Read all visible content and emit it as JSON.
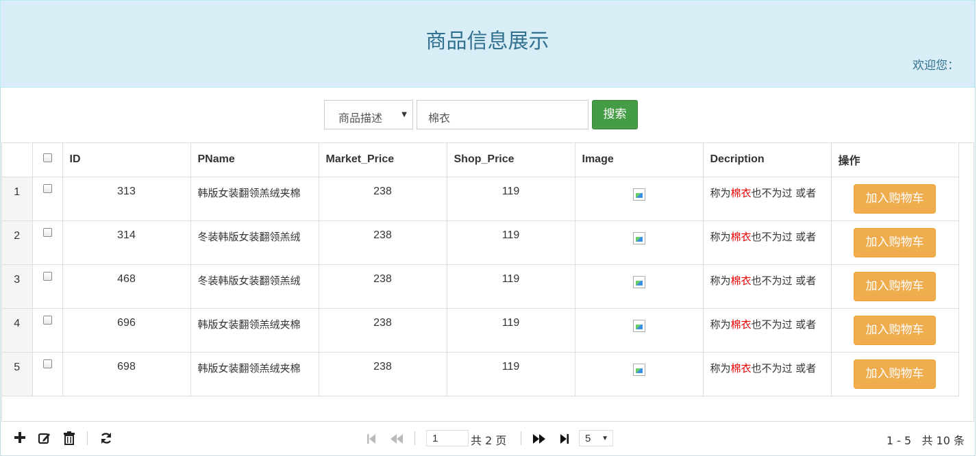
{
  "header": {
    "title": "商品信息展示",
    "welcome": "欢迎您："
  },
  "search": {
    "field_selected": "商品描述",
    "query": "棉衣",
    "button": "搜索"
  },
  "table": {
    "columns": [
      "ID",
      "PName",
      "Market_Price",
      "Shop_Price",
      "Image",
      "Decription",
      "操作"
    ],
    "rows": [
      {
        "num": "1",
        "id": "313",
        "pname": "韩版女装翻领羔绒夹棉",
        "market": "238",
        "shop": "119",
        "desc_pre": "称为",
        "desc_hl": "棉衣",
        "desc_post": "也不为过 或者",
        "action": "加入购物车"
      },
      {
        "num": "2",
        "id": "314",
        "pname": "冬装韩版女装翻领羔绒",
        "market": "238",
        "shop": "119",
        "desc_pre": "称为",
        "desc_hl": "棉衣",
        "desc_post": "也不为过 或者",
        "action": "加入购物车"
      },
      {
        "num": "3",
        "id": "468",
        "pname": "冬装韩版女装翻领羔绒",
        "market": "238",
        "shop": "119",
        "desc_pre": "称为",
        "desc_hl": "棉衣",
        "desc_post": "也不为过 或者",
        "action": "加入购物车"
      },
      {
        "num": "4",
        "id": "696",
        "pname": "韩版女装翻领羔绒夹棉",
        "market": "238",
        "shop": "119",
        "desc_pre": "称为",
        "desc_hl": "棉衣",
        "desc_post": "也不为过 或者",
        "action": "加入购物车"
      },
      {
        "num": "5",
        "id": "698",
        "pname": "韩版女装翻领羔绒夹棉",
        "market": "238",
        "shop": "119",
        "desc_pre": "称为",
        "desc_hl": "棉衣",
        "desc_post": "也不为过 或者",
        "action": "加入购物车"
      }
    ]
  },
  "pager": {
    "current_page": "1",
    "total_pages": "共 2 页",
    "page_size": "5",
    "range": "1 - 5   共 10 条"
  },
  "colors": {
    "header_bg": "#d9edf7",
    "title": "#31708f",
    "search_btn": "#449d44",
    "cart_btn": "#f0ad4e",
    "highlight": "#e00000"
  },
  "icons": [
    "plus-icon",
    "edit-icon",
    "trash-icon",
    "refresh-icon",
    "first-page-icon",
    "prev-page-icon",
    "next-page-icon",
    "last-page-icon"
  ]
}
